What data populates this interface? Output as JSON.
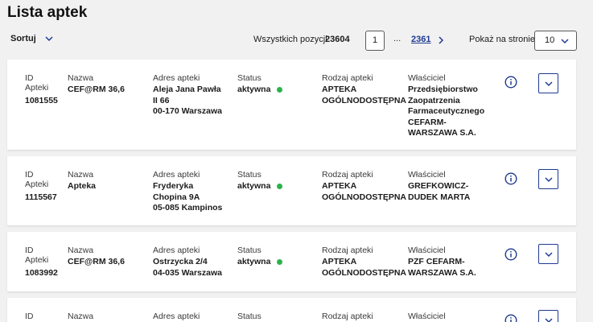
{
  "page": {
    "title": "Lista aptek"
  },
  "toolbar": {
    "sort_label": "Sortuj",
    "total_label": "Wszystkich pozycji",
    "total_value": "23604",
    "current_page": "1",
    "ellipsis": "...",
    "last_page": "2361",
    "per_page_label": "Pokaż na stronie",
    "per_page_value": "10"
  },
  "columns": {
    "id": "ID\nApteki",
    "name": "Nazwa",
    "address": "Adres apteki",
    "status": "Status",
    "type": "Rodzaj apteki",
    "owner": "Właściciel"
  },
  "rows": [
    {
      "id": "1081555",
      "name": "CEF@RM 36,6",
      "address": "Aleja Jana Pawła\nII 66\n00-170 Warszawa",
      "status": "aktywna",
      "type": "APTEKA\nOGÓLNODOSTĘPNA",
      "owner": "Przedsiębiorstwo\nZaopatrzenia\nFarmaceutycznego\nCEFARM-\nWARSZAWA S.A."
    },
    {
      "id": "1115567",
      "name": "Apteka",
      "address": "Fryderyka\nChopina 9A\n05-085 Kampinos",
      "status": "aktywna",
      "type": "APTEKA\nOGÓLNODOSTĘPNA",
      "owner": "GREFKOWICZ-\nDUDEK MARTA"
    },
    {
      "id": "1083992",
      "name": "CEF@RM 36,6",
      "address": "Ostrzycka 2/4\n04-035 Warszawa",
      "status": "aktywna",
      "type": "APTEKA\nOGÓLNODOSTĘPNA",
      "owner": "PZF CEFARM-\nWARSZAWA S.A."
    }
  ],
  "colors": {
    "accent": "#1f3a93",
    "status_active": "#2bb24c"
  }
}
